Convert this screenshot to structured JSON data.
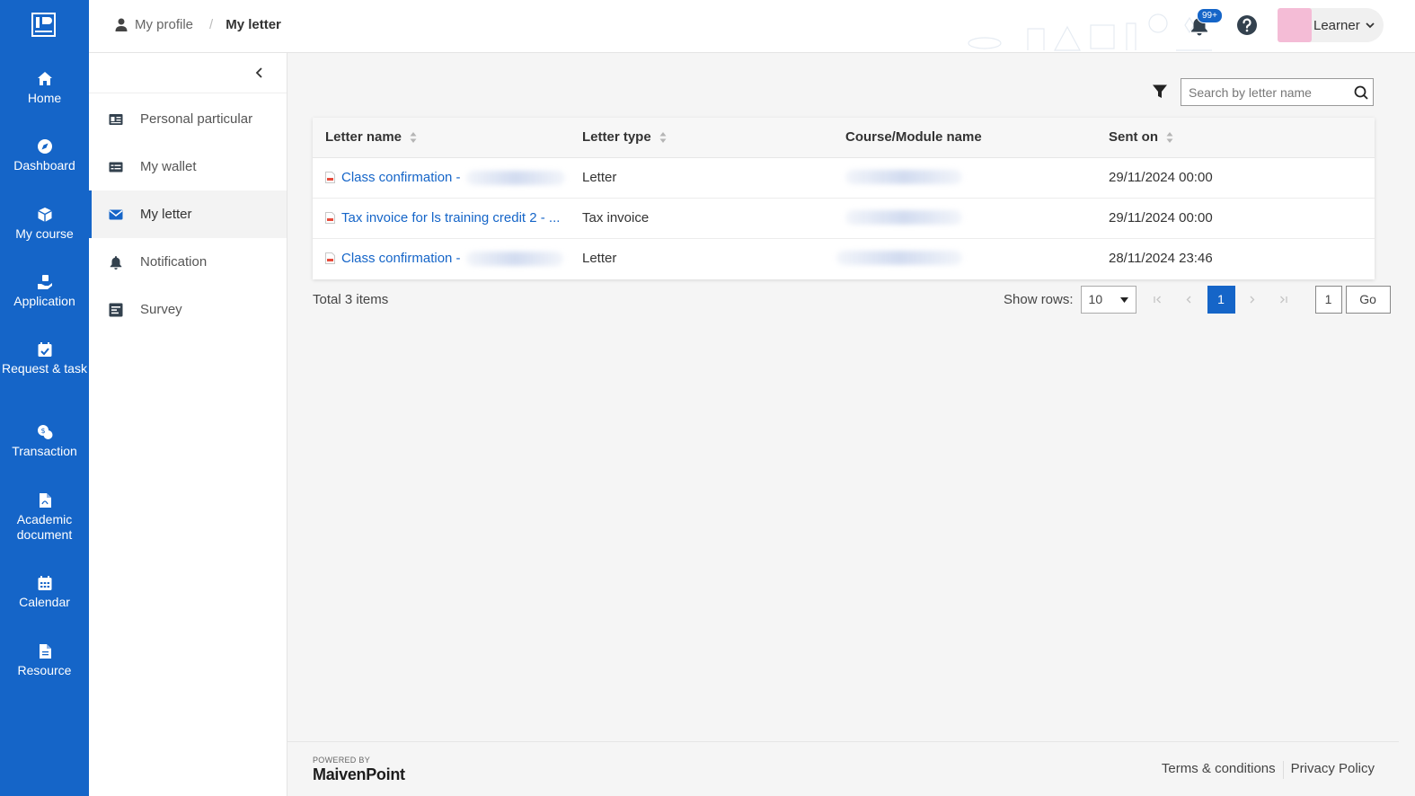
{
  "rail": {
    "items": [
      {
        "label": "Home",
        "icon": "home-icon"
      },
      {
        "label": "Dashboard",
        "icon": "compass-icon"
      },
      {
        "label": "My course",
        "icon": "cube-icon"
      },
      {
        "label": "Application",
        "icon": "hand-box-icon"
      },
      {
        "label": "Request & task",
        "icon": "calendar-check-icon"
      },
      {
        "label": "Transaction",
        "icon": "coins-icon"
      },
      {
        "label": "Academic document",
        "icon": "pdf-file-icon"
      },
      {
        "label": "Calendar",
        "icon": "calendar-icon"
      },
      {
        "label": "Resource",
        "icon": "file-icon"
      }
    ]
  },
  "header": {
    "breadcrumb": {
      "parent": "My profile",
      "current": "My letter"
    },
    "notification_badge": "99+",
    "user_name": "Learner"
  },
  "subnav": {
    "items": [
      {
        "label": "Personal particular",
        "icon": "id-card-icon"
      },
      {
        "label": "My wallet",
        "icon": "wallet-icon"
      },
      {
        "label": "My letter",
        "icon": "envelope-icon",
        "active": true
      },
      {
        "label": "Notification",
        "icon": "bell-icon"
      },
      {
        "label": "Survey",
        "icon": "survey-icon"
      }
    ]
  },
  "search": {
    "placeholder": "Search by letter name",
    "value": ""
  },
  "table": {
    "columns": [
      "Letter name",
      "Letter type",
      "Course/Module name",
      "Sent on"
    ],
    "rows": [
      {
        "name": "Class confirmation -",
        "type": "Letter",
        "sent": "29/11/2024 00:00"
      },
      {
        "name": "Tax invoice for ls training credit 2 - ...",
        "type": "Tax invoice",
        "sent": "29/11/2024 00:00"
      },
      {
        "name": "Class confirmation -",
        "type": "Letter",
        "sent": "28/11/2024 23:46"
      }
    ]
  },
  "pagination": {
    "total": "Total 3 items",
    "show_rows_label": "Show rows:",
    "rows_per_page": "10",
    "current_page": "1",
    "page_input": "1",
    "go_label": "Go"
  },
  "footer": {
    "powered_by": "POWERED BY",
    "brand": "MaivenPoint",
    "terms": "Terms & conditions",
    "privacy": "Privacy Policy"
  },
  "colors": {
    "primary": "#1565c8",
    "rail_bg": "#1565c8",
    "avatar": "#f4bcd6"
  }
}
